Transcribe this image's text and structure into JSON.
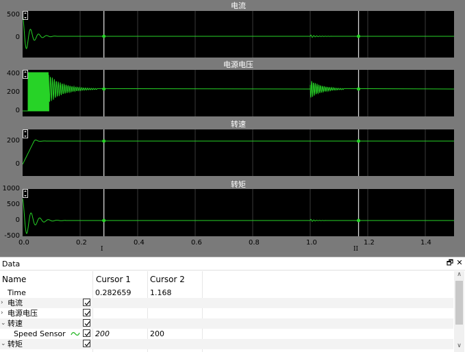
{
  "plots": [
    {
      "title": "电流",
      "yticks": [
        "500",
        "0"
      ]
    },
    {
      "title": "电源电压",
      "yticks": [
        "400",
        "200",
        "0"
      ]
    },
    {
      "title": "转速",
      "yticks": [
        "200",
        "0"
      ]
    },
    {
      "title": "转矩",
      "yticks": [
        "1000",
        "500",
        "0",
        "-500"
      ]
    }
  ],
  "x_ticks": [
    "0.0",
    "0.2",
    "0.4",
    "0.6",
    "0.8",
    "1.0",
    "1.2",
    "1.4"
  ],
  "cursors": [
    {
      "label": "I",
      "x": 0.282659
    },
    {
      "label": "II",
      "x": 1.168
    }
  ],
  "colors": {
    "trace": "#27d327",
    "background": "#000000",
    "grid": "#3a3a3a"
  },
  "data_panel": {
    "title": "Data",
    "columns": [
      "Name",
      "Cursor 1",
      "Cursor 2"
    ],
    "rows": [
      {
        "name": "Time",
        "c1": "0.282659",
        "c2": "1.168"
      },
      {
        "name": "电流",
        "c1": "",
        "c2": ""
      },
      {
        "name": "电源电压",
        "c1": "",
        "c2": ""
      },
      {
        "name": "转速",
        "c1": "",
        "c2": ""
      },
      {
        "name": "Speed Sensor",
        "c1": "200",
        "c2": "200"
      },
      {
        "name": "转矩",
        "c1": "",
        "c2": ""
      }
    ]
  }
}
